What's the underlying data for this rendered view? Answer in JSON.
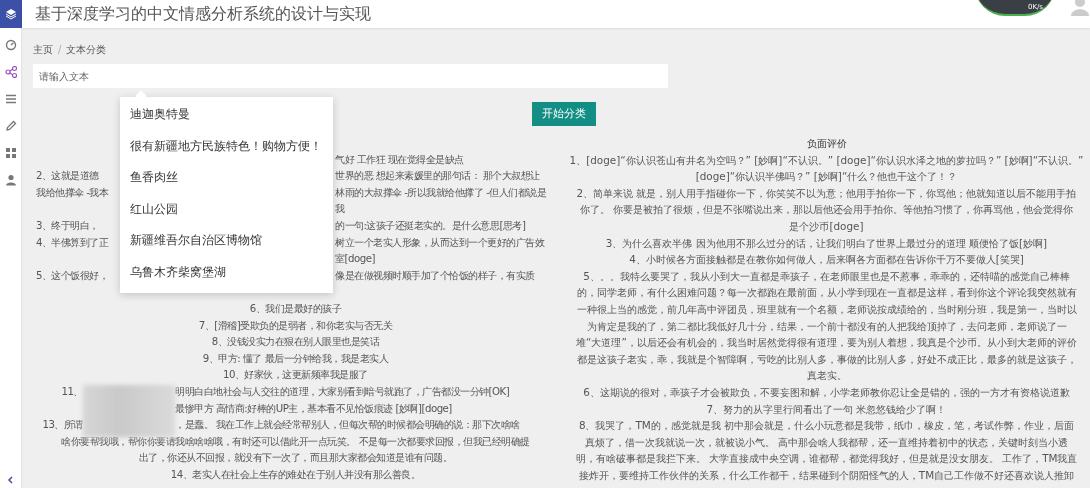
{
  "sidebar": {
    "items": [
      {
        "kind": "dashboard",
        "selected": false
      },
      {
        "kind": "share",
        "selected": true
      },
      {
        "kind": "list",
        "selected": false
      },
      {
        "kind": "edit",
        "selected": false
      },
      {
        "kind": "grid",
        "selected": false
      },
      {
        "kind": "user",
        "selected": false
      }
    ]
  },
  "header": {
    "title": "基于深度学习的中文情感分析系统的设计与实现",
    "speed_meter": {
      "reading": "0K/s"
    }
  },
  "breadcrumb": {
    "items": [
      "主页",
      "文本分类"
    ],
    "separator": "/"
  },
  "search": {
    "placeholder": "请输入文本",
    "suggestions": [
      "迪迦奥特曼",
      "很有新疆地方民族特色！购物方便！",
      "鱼香肉丝",
      "红山公园",
      "新疆维吾尔自治区博物馆",
      "乌鲁木齐柴窝堡湖"
    ]
  },
  "button": {
    "label": "开始分类"
  },
  "positive": {
    "rows": [
      {
        "kind": "behind_menu",
        "right": "气好 工作狂 现在觉得全是缺点"
      },
      {
        "kind": "behind_menu",
        "left": "2、这就是道德",
        "right": "世界的恶 想起来素媛里的那句话： 那个大叔想让"
      },
      {
        "kind": "behind_menu",
        "left": "我给他撑伞 -我本",
        "right": "林雨的大叔撑伞 -所以我就给他撑了 -但人们都说是"
      },
      {
        "kind": "behind_menu",
        "right": "我"
      },
      {
        "kind": "behind_menu",
        "left": "3、终于明白，",
        "right": "的一句:这孩子还挺老实的。是什么意思[思考]"
      },
      {
        "kind": "behind_menu",
        "left": "4、半佛算到了正",
        "right": "树立一个老实人形象，从而达到一个更好的广告效"
      },
      {
        "kind": "behind_menu",
        "right": "室[doge]"
      },
      {
        "kind": "behind_menu",
        "left": "5、这个饭很好，",
        "right": "像是在做视频时顺手加了个恰饭的样子，有实质"
      },
      {
        "kind": "covered"
      },
      {
        "kind": "full",
        "text": "6、我们是最好的孩子"
      },
      {
        "kind": "full",
        "text": "7、[滑稽]受欺负的是弱者，和你老实与否无关"
      },
      {
        "kind": "full",
        "text": "8、没钱没实力在狠在别人眼里也是笑话"
      },
      {
        "kind": "full",
        "text": "9、甲方: 懂了 最后一分钟给我，我是老实人"
      },
      {
        "kind": "full",
        "text": "10、好家伙，这更新频率我是服了"
      },
      {
        "kind": "behind_blur",
        "left": "11、",
        "right": "明明白白地社会与人交往的道理，大家别看到暗号就跑了，广告都没一分钟[OK]"
      },
      {
        "kind": "behind_blur",
        "right": "最惨甲方 高情商:好棒的UP主，基本看不见恰饭痕迹 [妙啊][doge]"
      },
      {
        "kind": "behind_blur",
        "left": "13、所谓",
        "right": "，是蠢。 我在工作上就会经常帮别人，但每次帮的时候都会明确的说：那下次啥啥"
      },
      {
        "kind": "full",
        "text": "啥你要帮我哦，帮你你要请我啥啥啥哦，有时还可以借此开一点玩笑。 不是每一次都要求回报，但我已经明确提"
      },
      {
        "kind": "full",
        "text": "出了，你还从不回报，就没有下一次了，而且那大家都会知道是谁有问题。"
      },
      {
        "kind": "full",
        "text": "14、老实人在社会上生存的难处在于别人并没有那么善良。"
      }
    ]
  },
  "negative": {
    "heading": "负面评价",
    "items": [
      {
        "lines": [
          "1、[doge]“你认识苍山有井名为空吗？” [妙啊]“不认识。” [doge]“你认识水泽之地的萝拉吗？” [妙啊]“不认识。”",
          "[doge]“你认识半佛吗？” [妙啊]“什么？他也干这个了！？"
        ]
      },
      {
        "lines": [
          "2、简单来说 就是，别人用手指碰你一下，你笑笑不以为意；他用手拍你一下，你骂他；他就知道以后不能用手拍",
          "你了。 你要是被拍了很烦，但是不张嘴说出来，那以后他还会用手拍你。等他拍习惯了，你再骂他，他会觉得你",
          "是个沙币[doge]"
        ]
      },
      {
        "lines": [
          "3、为什么喜欢半佛 因为他用不那么过分的话，让我们明白了世界上最过分的道理 顺便恰了饭[妙啊]"
        ]
      },
      {
        "lines": [
          "4、小时候各方面接触都是在教你如何做人，后来啊各方面都在告诉你千万不要做人[笑哭]"
        ]
      },
      {
        "lines": [
          "5、。。我特么要哭了，我从小到大一直都是乖孩子，在老师眼里也是不惹事，乖乖的，还特喵的感觉自己棒棒",
          "的，同学老师，有什么困难问题？每一次都跑在最前面，从小学到现在一直都是这样，看到你这个评论我突然就有",
          "一种很上当的感觉，前几年高中评团员，班里就有一个名额，老师说按成绩给的，当时刚分班，我是第一，当时以",
          "为肯定是我的了，第二都比我低好几十分，结果，一个前十都没有的人把我给顶掉了，去问老师，老师说了一",
          "堆“大道理”，以后还会有机会的，我当时居然觉得很有道理，要为别人着想，我真是个沙币。从小到大老师的评价",
          "都是这孩子老实，乖，我就是个智障啊，亏吃的比别人多，事做的比别人多，好处不成正比，最多的就是这孩子，",
          "真老实。"
        ]
      },
      {
        "lines": [
          "6、这期说的很对，乖孩子才会被欺负，不要妄图和解，小学老师教你忍让全是错的，强的一方才有资格说道歉"
        ]
      },
      {
        "lines": [
          "7、努力的从字里行间看出了一句 米忽悠钱给少了啊！"
        ]
      },
      {
        "lines": [
          "8、我哭了，TM的，感觉就是我 初中那会就是，什么小玩意都是我带，纸巾，橡皮，笔，考试作弊，作业，后面",
          "真烦了，借一次我就说一次，就被说小气。 高中那会啥人我都帮，还一直维持着初中的状态，关键时刻当小透",
          "明，有啥破事都是我拦下来。 大学直接成中央空调，谁都帮，都觉得我好，但是就是没女朋友。 工作了，TM我直",
          "接炸开，要维持工作伙伴的关系，什么工作都干，结果碰到个阴阳怪气的人，TM自己工作做不好还喜欢说人推卸"
        ]
      }
    ]
  }
}
